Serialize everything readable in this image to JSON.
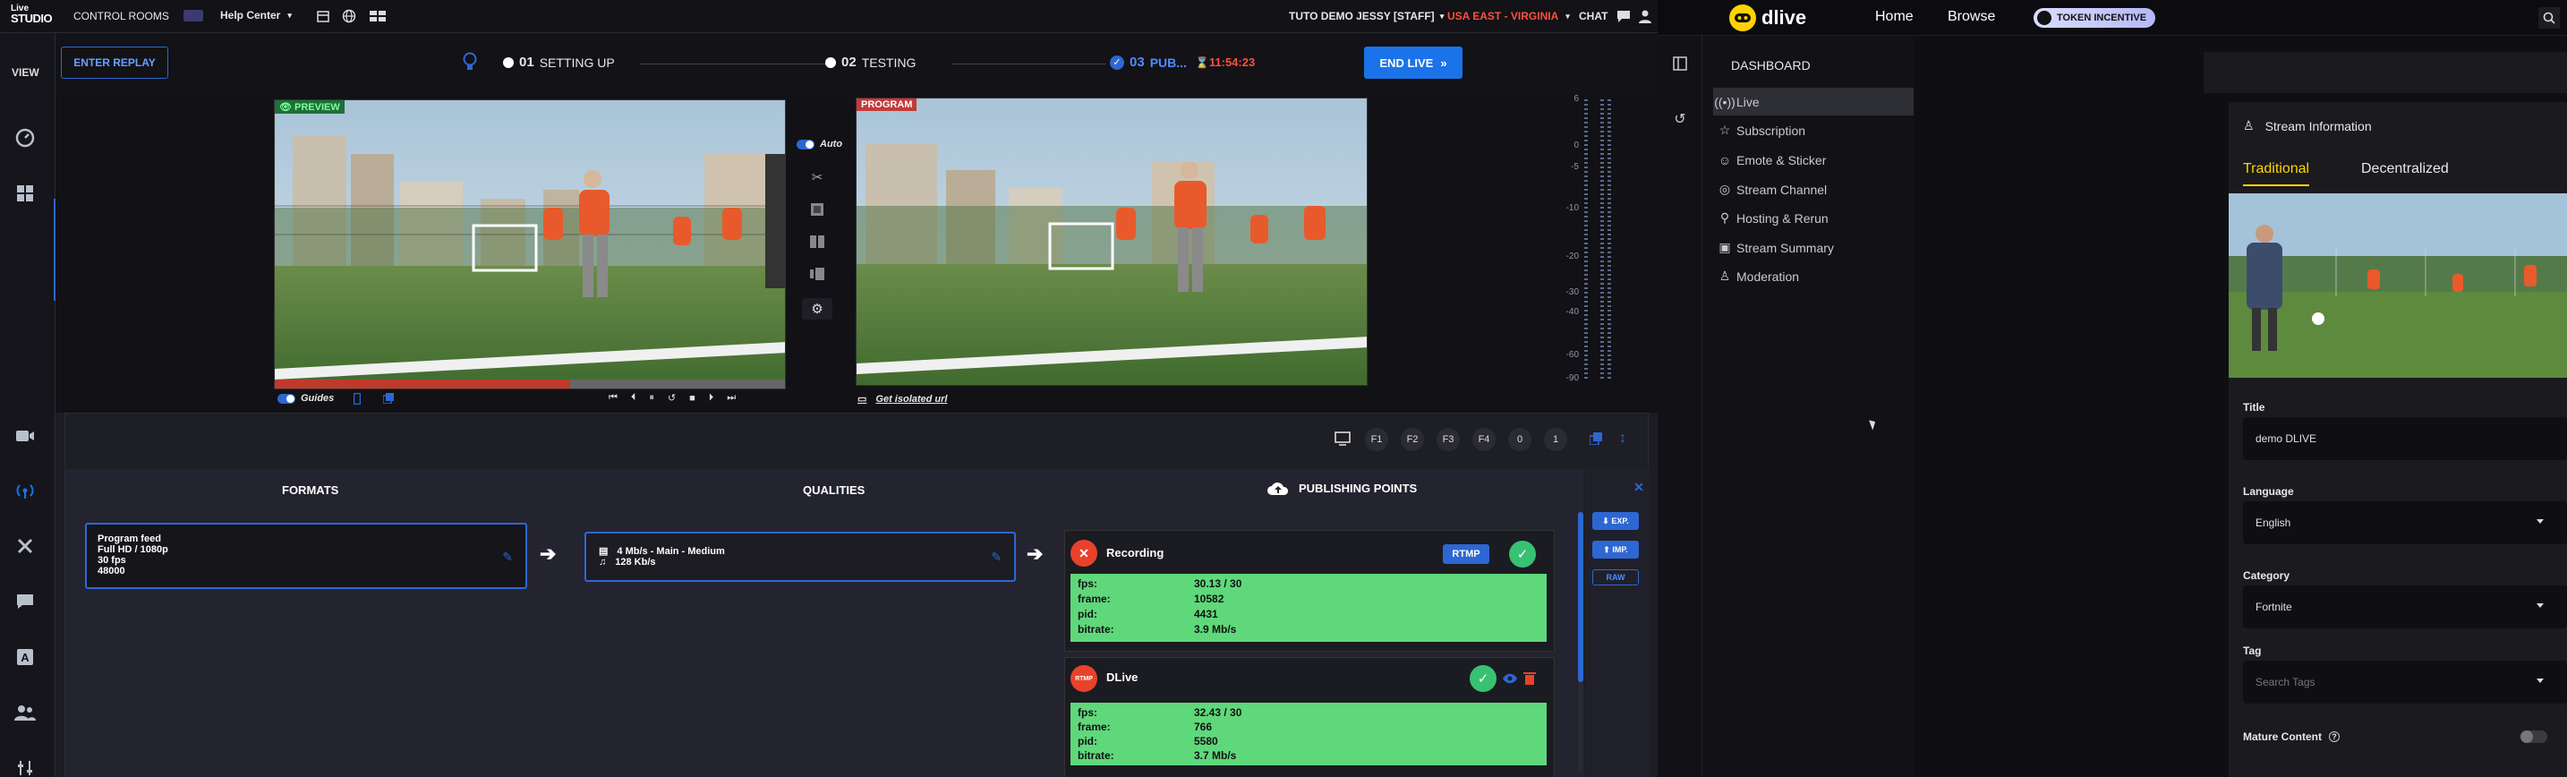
{
  "studio": {
    "logo_top": "Live",
    "logo_bottom": "STUDIO",
    "nav_control_rooms": "CONTROL ROOMS",
    "nav_help": "Help Center",
    "user": "TUTO DEMO JESSY [STAFF]",
    "region": "USA EAST - VIRGINIA",
    "chat": "CHAT",
    "view": "VIEW",
    "enter_replay": "ENTER REPLAY",
    "steps": [
      {
        "num": "01",
        "label": "SETTING UP"
      },
      {
        "num": "02",
        "label": "TESTING"
      },
      {
        "num": "03",
        "label": "PUB..."
      }
    ],
    "timer": "11:54:23",
    "end_live": "END LIVE",
    "preview_tag": "PREVIEW",
    "program_tag": "PROGRAM",
    "auto_label": "Auto",
    "guides_label": "Guides",
    "isolated_url": "Get isolated url",
    "vu_labels": [
      "6",
      "0",
      "-5",
      "-10",
      "-20",
      "-30",
      "-40",
      "-60",
      "-90"
    ],
    "fkeys": [
      "F1",
      "F2",
      "F3",
      "F4",
      "0",
      "1"
    ],
    "col_formats": "FORMATS",
    "col_qualities": "QUALITIES",
    "col_publishing": "PUBLISHING POINTS",
    "format_lines": [
      "Program feed",
      "Full HD / 1080p",
      "30 fps",
      "48000"
    ],
    "quality_lines": [
      "4 Mb/s  -  Main  -  Medium",
      "128 Kb/s"
    ],
    "side_buttons": [
      "EXP.",
      "IMP.",
      "RAW"
    ],
    "publishing": [
      {
        "name": "Recording",
        "badge": "RTMP",
        "stats": [
          {
            "k": "fps:",
            "v": "30.13 / 30"
          },
          {
            "k": "frame:",
            "v": "10582"
          },
          {
            "k": "pid:",
            "v": "4431"
          },
          {
            "k": "bitrate:",
            "v": "3.9 Mb/s"
          }
        ]
      },
      {
        "name": "DLive",
        "icon_text": "RTMP",
        "stats": [
          {
            "k": "fps:",
            "v": "32.43 / 30"
          },
          {
            "k": "frame:",
            "v": "766"
          },
          {
            "k": "pid:",
            "v": "5580"
          },
          {
            "k": "bitrate:",
            "v": "3.7 Mb/s"
          }
        ]
      }
    ]
  },
  "dlive": {
    "brand": "dlive",
    "nav_home": "Home",
    "nav_browse": "Browse",
    "token_incentive": "TOKEN INCENTIVE",
    "dashboard": "DASHBOARD",
    "menu": [
      "Live",
      "Subscription",
      "Emote & Sticker",
      "Stream Channel",
      "Hosting & Rerun",
      "Stream Summary",
      "Moderation"
    ],
    "stream_info": "Stream Information",
    "tab_traditional": "Traditional",
    "tab_decentralized": "Decentralized",
    "title_label": "Title",
    "title_value": "demo DLIVE",
    "language_label": "Language",
    "language_value": "English",
    "category_label": "Category",
    "category_value": "Fortnite",
    "tag_label": "Tag",
    "tag_placeholder": "Search Tags",
    "mature_label": "Mature Content"
  },
  "colors": {
    "accent_blue": "#1a73e8",
    "live_red": "#ff3b30",
    "ok_green": "#38c172",
    "dlive_yellow": "#ffd300"
  }
}
